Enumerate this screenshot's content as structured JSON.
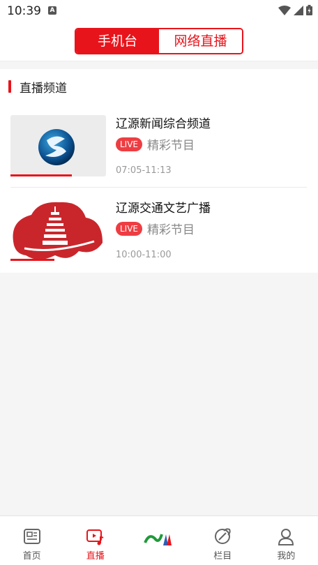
{
  "status_bar": {
    "time": "10:39",
    "notification_badge": "A"
  },
  "top_tabs": {
    "active": "手机台",
    "inactive": "网络直播"
  },
  "section": {
    "title": "直播频道"
  },
  "channels": [
    {
      "name": "辽源新闻综合频道",
      "live_badge": "LIVE",
      "program": "精彩节目",
      "time": "07:05-11:13",
      "progress": 0.64
    },
    {
      "name": "辽源交通文艺广播",
      "live_badge": "LIVE",
      "program": "精彩节目",
      "time": "10:00-11:00",
      "progress": 0.46
    }
  ],
  "bottom_nav": [
    {
      "label": "首页",
      "icon": "news-icon",
      "active": false
    },
    {
      "label": "直播",
      "icon": "live-video-icon",
      "active": true
    },
    {
      "label": "",
      "icon": "brand-logo-icon",
      "active": false
    },
    {
      "label": "栏目",
      "icon": "column-icon",
      "active": false
    },
    {
      "label": "我的",
      "icon": "profile-icon",
      "active": false
    }
  ],
  "colors": {
    "accent": "#e8141b",
    "live_badge": "#ee3d42"
  }
}
